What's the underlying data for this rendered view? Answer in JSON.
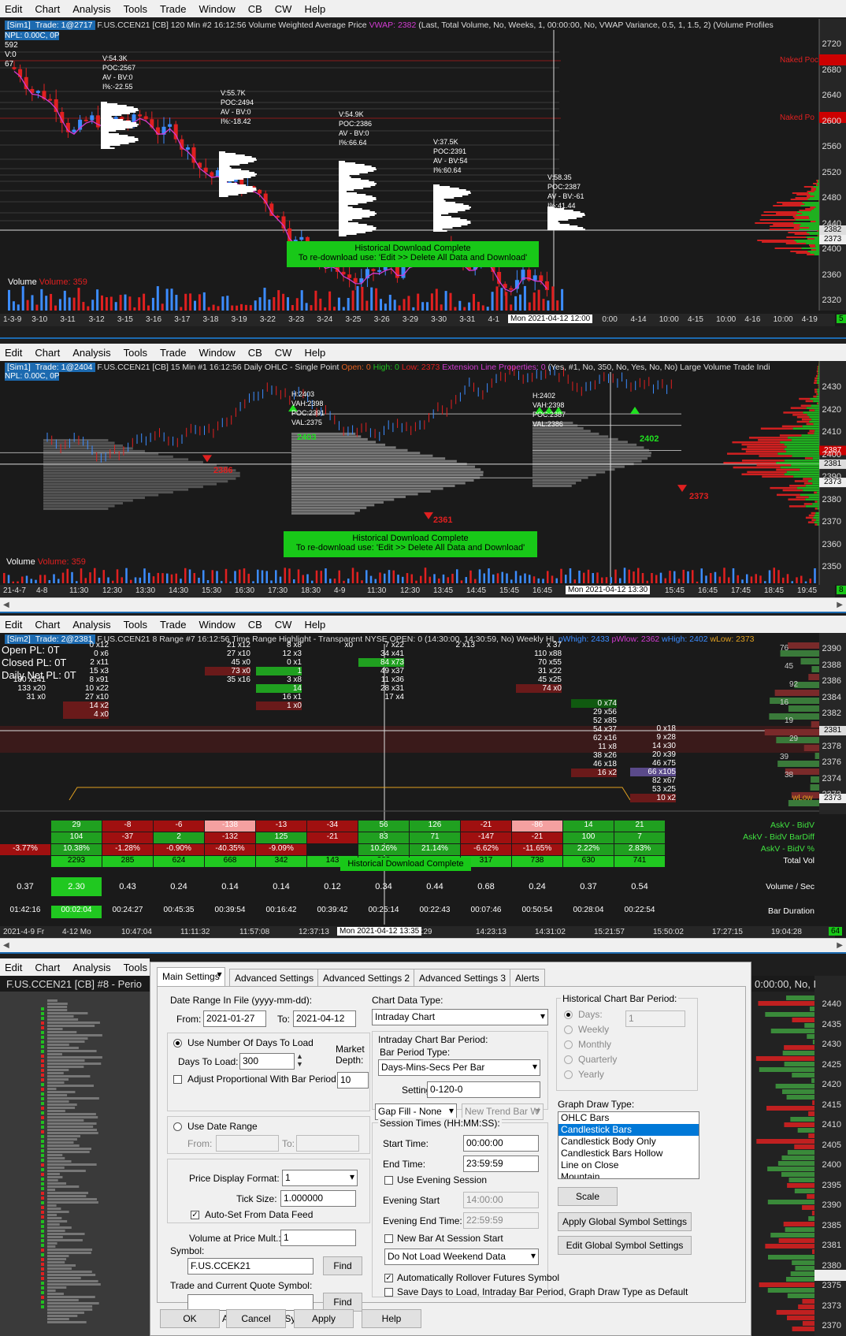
{
  "menu": [
    "Edit",
    "Chart",
    "Analysis",
    "Tools",
    "Trade",
    "Window",
    "CB",
    "CW",
    "Help"
  ],
  "chart1": {
    "sim": "[Sim1]",
    "trade": "Trade: 1@2717",
    "info": "F.US.CCEN21 [CB]  120 Min  #2 16:12:56 Volume Weighted Average Price",
    "vwap_label": "VWAP: 2382",
    "params": "(Last, Total Volume, No, Weeks, 1, 00:00:00, No, VWAP Variance, 0.5, 1, 1.5, 2)  (Volume Profiles",
    "npl": "NPL: 0.00C, 0P",
    "side": [
      "592",
      "V:0",
      "67"
    ],
    "annotations": [
      "V:54.3K\nPOC:2567\nAV - BV:0\nI%:-22.55",
      "V:55.7K\nPOC:2494\nAV - BV:0\nI%:-18.42",
      "V:54.9K\nPOC:2386\nAV - BV:0\nI%:66.64",
      "V:37.5K\nPOC:2391\nAV - BV:54\nI%:60.64",
      "V:58.35\nPOC:2387\nAV - BV:-61\nI%:41.44"
    ],
    "download": [
      "Historical Download Complete",
      "To re-download use: 'Edit >> Delete All Data and Download'"
    ],
    "volume_label": "Volume",
    "volume_value": "Volume: 359",
    "yaxis": [
      "2720",
      "2680",
      "2640",
      "2600",
      "2560",
      "2520",
      "2480",
      "2440",
      "2400",
      "2360",
      "2320"
    ],
    "right_labels": [
      "Naked Poc",
      "Naked Po",
      "2382",
      "2373"
    ],
    "xaxis": [
      "1-3-9",
      "3-10",
      "3-11",
      "3-12",
      "3-15",
      "3-16",
      "3-17",
      "3-18",
      "3-19",
      "3-22",
      "3-23",
      "3-24",
      "3-25",
      "3-26",
      "3-29",
      "3-30",
      "3-31",
      "4-1",
      "4-5",
      "4-6",
      "4-7",
      "0:00",
      "4-14",
      "10:00",
      "4-15",
      "10:00",
      "4-16",
      "10:00",
      "4-19"
    ],
    "cursor_time": "Mon 2021-04-12  12:00",
    "corner": "5"
  },
  "chart2": {
    "sim": "[Sim1]",
    "trade": "Trade: 1@2404",
    "info": "F.US.CCEN21 [CB]  15 Min  #1 16:12:56 Daily OHLC - Single Point",
    "open": "Open: 0",
    "high": "High: 0",
    "low": "Low: 2373",
    "ext": "Extension Line Properties: 0",
    "params": "(Yes, #1, No, 350, No, Yes, No, No)  Large Volume Trade Indi",
    "npl": "NPL: 0.00C, 0P",
    "annotations": [
      "H:2403\nVAH:2398\nPOC:2391\nVAL:2375",
      "H:2402\nVAH:2398\nPOC:2387\nVAL:2386"
    ],
    "markers": [
      "2386",
      "2403",
      "2361",
      "2402",
      "2373"
    ],
    "download": [
      "Historical Download Complete",
      "To re-download use: 'Edit >> Delete All Data and Download'"
    ],
    "volume_label": "Volume",
    "volume_value": "Volume: 359",
    "yaxis": [
      "2430",
      "2420",
      "2410",
      "2400",
      "2390",
      "2380",
      "2370",
      "2360",
      "2350"
    ],
    "right_labels": [
      "2387",
      "2381",
      "2373"
    ],
    "xaxis": [
      "21-4-7",
      "4-8",
      "11:30",
      "12:30",
      "13:30",
      "14:30",
      "15:30",
      "16:30",
      "17:30",
      "18:30",
      "4-9",
      "11:30",
      "12:30",
      "13:45",
      "14:45",
      "15:45",
      "16:45",
      "17:45",
      "4-12",
      "11:",
      "15:45",
      "16:45",
      "17:45",
      "18:45",
      "19:45"
    ],
    "cursor_time": "Mon 2021-04-12  13:30",
    "corner": "8"
  },
  "chart3": {
    "sim": "[Sim2]",
    "trade": "Trade: 2@2381",
    "info": "F.US.CCEN21  8 Range  #7 16:12:56 Time Range Highlight - Transparent  NYSE OPEN: 0  (14:30:00, 14:30:59, No)  Weekly HL",
    "pwhigh": "pWhigh: 2433",
    "pwlow": "pWlow: 2362",
    "whigh": "wHigh: 2402",
    "wlow": "wLow: 2373",
    "pl": [
      "Open PL: 0T",
      "Closed PL: 0T",
      "Daily Net PL: 0T"
    ],
    "yaxis": [
      "2390",
      "2388",
      "2386",
      "2384",
      "2382",
      "2380",
      "2378",
      "2376",
      "2374",
      "2372"
    ],
    "right_labels": [
      "2381",
      "2373"
    ],
    "wlow_label": "wLow",
    "right_nums": [
      "76",
      "45",
      "92",
      "16",
      "19",
      "29",
      "39",
      "38"
    ],
    "cols": [
      [
        "",
        "",
        "",
        "",
        "",
        "",
        "",
        ""
      ],
      [
        "0 x12",
        "0 x6",
        "2 x11",
        "15 x3",
        "8 x91",
        "10 x22",
        "27 x10",
        "14 x2",
        "4 x0"
      ],
      [
        "21 x12",
        "27 x10",
        "45 x0",
        "73 x0",
        "35 x16"
      ],
      [
        "8 x8",
        "12 x3",
        "0 x1",
        "1",
        "3 x8",
        "14",
        "16 x1",
        "1 x0"
      ],
      [
        "x0"
      ],
      [
        "7 x22",
        "34 x41",
        "84 x73",
        "49 x37",
        "11 x36",
        "28 x31",
        "17 x4"
      ],
      [
        "2 x13"
      ],
      [
        "x 37",
        "110 x88",
        "70 x55",
        "31 x22",
        "45 x25",
        "74 x0"
      ],
      [
        "0 x74",
        "29 x56",
        "52 x85",
        "54 x37",
        "62 x16",
        "11 x8",
        "38 x26",
        "46 x18",
        "16 x2"
      ],
      [
        "0 x18",
        "9 x28",
        "14 x30",
        "20 x39",
        "46 x75",
        "66 x105",
        "82 x67",
        "53 x25",
        "10 x2"
      ]
    ],
    "left_cells": [
      "180 x141",
      "133 x20",
      "31 x0"
    ],
    "rows": {
      "r1": [
        "29",
        "-8",
        "-6",
        "-138",
        "-13",
        "-34",
        "56",
        "126",
        "-21",
        "-86",
        "14",
        "21"
      ],
      "r2": [
        "104",
        "-37",
        "2",
        "-132",
        "125",
        "-21",
        "83",
        "71",
        "-147",
        "-21",
        "100",
        "7"
      ],
      "r3": [
        "-3.77%",
        "10.38%",
        "-1.28%",
        "-0.90%",
        "-40.35%",
        "-9.09%",
        "",
        "10.26%",
        "21.14%",
        "-6.62%",
        "-11.65%",
        "2.22%",
        "2.83%"
      ],
      "r4": [
        "2293",
        "285",
        "624",
        "668",
        "342",
        "143",
        "280",
        "",
        "317",
        "738",
        "630",
        "741"
      ],
      "vps": [
        "0.37",
        "2.30",
        "0.43",
        "0.24",
        "0.14",
        "0.14",
        "0.12",
        "0.34",
        "0.44",
        "0.68",
        "0.24",
        "0.37",
        "0.54"
      ],
      "dur": [
        "01:42:16",
        "00:02:04",
        "00:24:27",
        "00:45:35",
        "00:39:54",
        "00:16:42",
        "00:39:42",
        "00:25:14",
        "00:22:43",
        "00:07:46",
        "00:50:54",
        "00:28:04",
        "00:22:54"
      ]
    },
    "row_labels": [
      "AskV - BidV",
      "AskV - BidV BarDiff",
      "AskV - BidV %",
      "Total Vol",
      "Volume / Sec",
      "Bar Duration"
    ],
    "download": "Historical Download Complete",
    "xaxis": [
      "2021-4-9 Fr",
      "4-12 Mo",
      "10:47:04",
      "11:11:32",
      "11:57:08",
      "12:37:13",
      "12:55",
      "0:29",
      "14:23:13",
      "14:31:02",
      "15:21:57",
      "15:50:02",
      "17:27:15",
      "19:04:28"
    ],
    "cursor_time": "Mon 2021-04-12  13:35",
    "corner": "64"
  },
  "chart4": {
    "title": "F.US.CCEN21 [CB]  #8 - Perio",
    "title_right": "0:00:00, No, I",
    "yaxis": [
      "2440",
      "2435",
      "2430",
      "2425",
      "2420",
      "2415",
      "2410",
      "2405",
      "2400",
      "2395",
      "2390",
      "2385",
      "2381",
      "2380",
      "2375",
      "2373",
      "2370"
    ],
    "menu": [
      "Edit",
      "Chart",
      "Analysis",
      "Tools",
      "T"
    ]
  },
  "dialog": {
    "tabs": [
      "Main Settings",
      "Advanced Settings",
      "Advanced Settings 2",
      "Advanced Settings 3",
      "Alerts"
    ],
    "date_range_label": "Date Range In File (yyyy-mm-dd):",
    "from_label": "From:",
    "from_value": "2021-01-27",
    "to_label": "To:",
    "to_value": "2021-04-12",
    "use_days_label": "Use Number Of Days To Load",
    "days_label": "Days To Load:",
    "days_value": "300",
    "market_depth_label": "Market\nDepth:",
    "market_depth_value": "10",
    "adjust_label": "Adjust Proportional With Bar Period",
    "use_date_range_label": "Use Date Range",
    "from2_label": "From:",
    "to2_label": "To:",
    "price_format_label": "Price Display Format:",
    "price_format_value": "1",
    "tick_label": "Tick Size:",
    "tick_value": "1.000000",
    "autoset_label": "Auto-Set From Data Feed",
    "vap_label": "Volume at Price Mult.:",
    "vap_value": "1",
    "symbol_label": "Symbol:",
    "symbol_value": "F.US.CCEK21",
    "find": "Find",
    "trade_symbol_label": "Trade and Current Quote Symbol:",
    "trade_symbol_value": "",
    "trade_only_label": "Use As Trade Only Symbol",
    "chart_type_label": "Chart Data Type:",
    "chart_type_value": "Intraday Chart",
    "intraday_period_label": "Intraday Chart Bar Period:",
    "bar_type_label": "Bar Period Type:",
    "bar_type_value": "Days-Mins-Secs Per Bar",
    "setting_label": "Setting:",
    "setting_value": "0-120-0",
    "gap_fill": "Gap Fill - None",
    "new_trend": "New Trend Bar W",
    "session_label": "Session Times (HH:MM:SS):",
    "start_label": "Start Time:",
    "start_value": "00:00:00",
    "end_label": "End Time:",
    "end_value": "23:59:59",
    "evening_label": "Use Evening Session",
    "evening_start_label": "Evening Start",
    "evening_start_value": "14:00:00",
    "evening_end_label": "Evening End Time:",
    "evening_end_value": "22:59:59",
    "new_bar_label": "New Bar At Session Start",
    "weekend_value": "Do Not Load Weekend Data",
    "rollover_label": "Automatically Rollover Futures Symbol",
    "save_default_label": "Save Days to Load, Intraday Bar Period, Graph Draw Type as Default",
    "hist_label": "Historical Chart Bar Period:",
    "hist_opts": [
      "Days:",
      "Weekly",
      "Monthly",
      "Quarterly",
      "Yearly"
    ],
    "hist_days_value": "1",
    "graph_label": "Graph Draw Type:",
    "graph_opts": [
      "OHLC Bars",
      "Candlestick Bars",
      "Candlestick Body Only",
      "Candlestick Bars Hollow",
      "Line on Close",
      "Mountain"
    ],
    "scale": "Scale",
    "apply_global": "Apply Global Symbol Settings",
    "edit_global": "Edit Global Symbol Settings",
    "ok": "OK",
    "cancel": "Cancel",
    "apply": "Apply",
    "help": "Help"
  }
}
